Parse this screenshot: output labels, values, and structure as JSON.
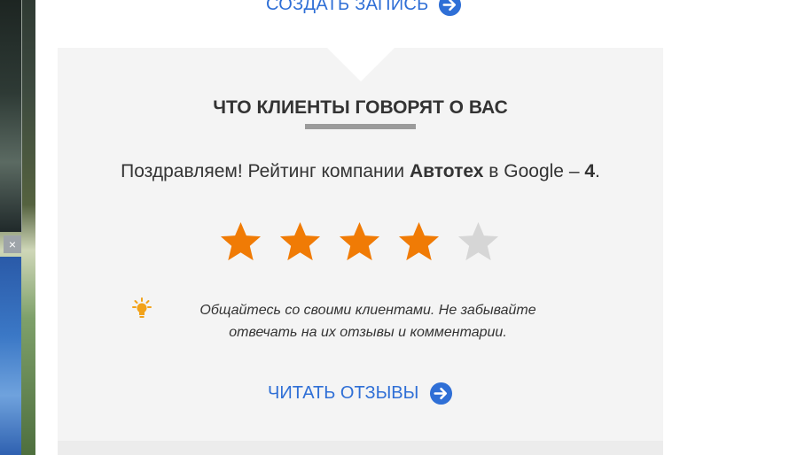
{
  "top_link": {
    "label": "СОЗДАТЬ ЗАПИСЬ",
    "icon": "arrow-right-circle-icon"
  },
  "close_button": {
    "label": "×"
  },
  "reviews": {
    "title": "ЧТО КЛИЕНТЫ ГОВОРЯТ О ВАС",
    "rating_prefix": "Поздравляем! Рейтинг компании ",
    "company": "Автотех",
    "rating_middle": " в Google – ",
    "rating_value": "4",
    "rating_suffix": ".",
    "stars_filled": 4,
    "stars_total": 5,
    "tip_line1": "Общайтесь со своими клиентами. Не забывайте",
    "tip_line2": "отвечать на их отзывы и комментарии.",
    "tip_icon": "lightbulb-icon",
    "read_link": "ЧИТАТЬ ОТЗЫВЫ"
  },
  "colors": {
    "star_filled": "#f07b05",
    "star_empty": "#d6d6d6",
    "link": "#2f6fd6",
    "card_bg": "#f4f4f4",
    "bulb": "#f2a21a"
  }
}
